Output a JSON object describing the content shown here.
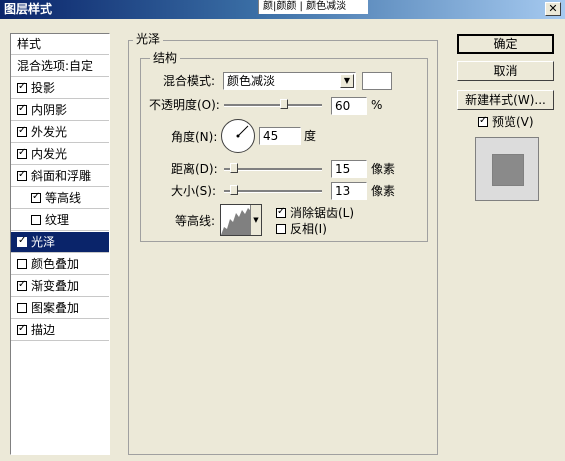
{
  "window": {
    "title": "图层样式",
    "strip_text": "颜|颜颜 | 颜色减淡",
    "close": "✕"
  },
  "left_panel": {
    "items": [
      {
        "label": "样式",
        "checkbox": false,
        "checked": false,
        "indent": false
      },
      {
        "label": "混合选项:自定",
        "checkbox": false,
        "checked": false,
        "indent": false
      },
      {
        "label": "投影",
        "checkbox": true,
        "checked": true,
        "indent": false
      },
      {
        "label": "内阴影",
        "checkbox": true,
        "checked": true,
        "indent": false
      },
      {
        "label": "外发光",
        "checkbox": true,
        "checked": true,
        "indent": false
      },
      {
        "label": "内发光",
        "checkbox": true,
        "checked": true,
        "indent": false
      },
      {
        "label": "斜面和浮雕",
        "checkbox": true,
        "checked": true,
        "indent": false
      },
      {
        "label": "等高线",
        "checkbox": true,
        "checked": true,
        "indent": true
      },
      {
        "label": "纹理",
        "checkbox": true,
        "checked": false,
        "indent": true
      },
      {
        "label": "光泽",
        "checkbox": true,
        "checked": true,
        "indent": false,
        "selected": true
      },
      {
        "label": "颜色叠加",
        "checkbox": true,
        "checked": false,
        "indent": false
      },
      {
        "label": "渐变叠加",
        "checkbox": true,
        "checked": true,
        "indent": false
      },
      {
        "label": "图案叠加",
        "checkbox": true,
        "checked": false,
        "indent": false
      },
      {
        "label": "描边",
        "checkbox": true,
        "checked": true,
        "indent": false
      }
    ]
  },
  "satin": {
    "group_title": "光泽",
    "structure_title": "结构",
    "blend_mode_label": "混合模式:",
    "blend_mode_value": "颜色减淡",
    "opacity_label": "不透明度(O):",
    "opacity_value": "60",
    "opacity_unit": "%",
    "angle_label": "角度(N):",
    "angle_value": "45",
    "angle_unit": "度",
    "distance_label": "距离(D):",
    "distance_value": "15",
    "distance_unit": "像素",
    "size_label": "大小(S):",
    "size_value": "13",
    "size_unit": "像素",
    "contour_label": "等高线:",
    "antialias_label": "消除锯齿(L)",
    "antialias_checked": true,
    "invert_label": "反相(I)",
    "invert_checked": false
  },
  "buttons": {
    "ok": "确定",
    "cancel": "取消",
    "new_style": "新建样式(W)...",
    "preview_label": "预览(V)",
    "preview_checked": true
  }
}
